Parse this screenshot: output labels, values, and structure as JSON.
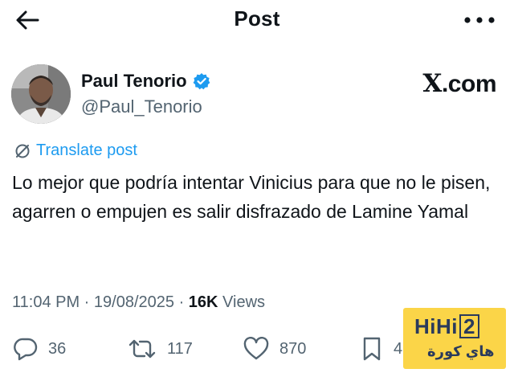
{
  "header": {
    "title": "Post",
    "back_icon": "arrow-left-icon",
    "more_icon": "more-horizontal-icon"
  },
  "author": {
    "name": "Paul Tenorio",
    "handle": "@Paul_Tenorio",
    "verified": true
  },
  "source_logo": {
    "x": "X",
    "domain": ".com"
  },
  "translate_label": "Translate post",
  "tweet": {
    "text": "Lo mejor que podría intentar Vinicius para que no le pisen, agarren o empujen es salir disfrazado de Lamine Yamal"
  },
  "meta": {
    "time": "11:04 PM",
    "separator": " · ",
    "date": "19/08/2025",
    "views_count": "16K",
    "views_label": " Views"
  },
  "actions": {
    "replies": "36",
    "reposts": "117",
    "likes": "870",
    "bookmarks": "4"
  },
  "watermark": {
    "line1": "HiHi",
    "line1_num": "2",
    "line2": "هاي كورة"
  },
  "colors": {
    "link": "#1d9bf0",
    "muted": "#536471",
    "text": "#0f1419",
    "watermark_bg": "#fbd548"
  }
}
